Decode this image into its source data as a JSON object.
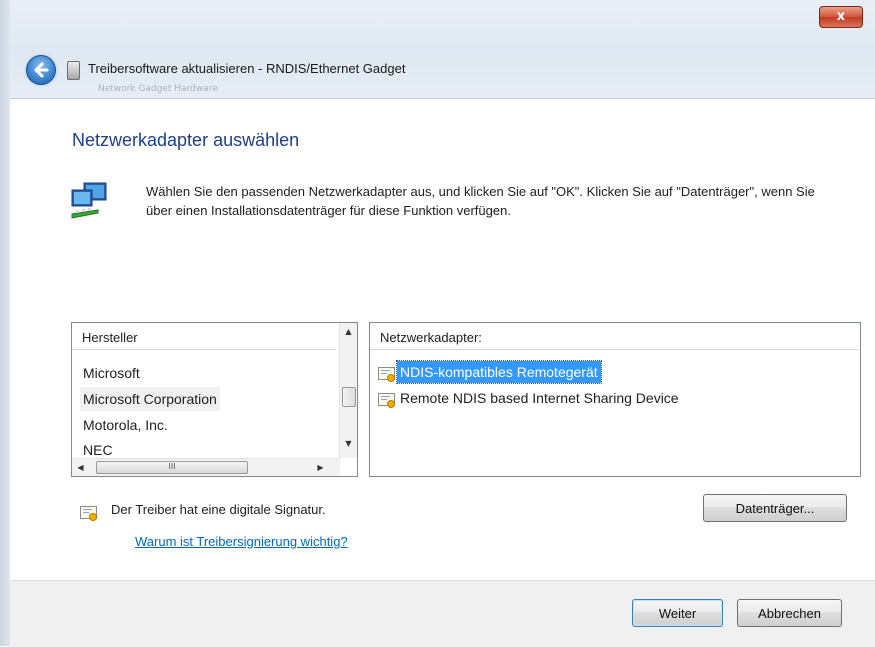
{
  "window": {
    "title": "Treibersoftware aktualisieren - RNDIS/Ethernet Gadget",
    "close_label": "x",
    "background_text": "Network Gadget Hardware"
  },
  "page": {
    "heading": "Netzwerkadapter auswählen",
    "instructions": "Wählen Sie den passenden Netzwerkadapter aus, und klicken Sie auf \"OK\". Klicken Sie auf \"Datenträger\", wenn Sie über einen Installationsdatenträger für diese Funktion verfügen."
  },
  "manufacturers": {
    "header": "Hersteller",
    "items": [
      {
        "label": "Microsoft",
        "selected": false
      },
      {
        "label": "Microsoft Corporation",
        "selected": true
      },
      {
        "label": "Motorola, Inc.",
        "selected": false
      },
      {
        "label": "NEC",
        "selected": false
      }
    ],
    "hscroll_thumb_label": "III"
  },
  "adapters": {
    "header": "Netzwerkadapter:",
    "items": [
      {
        "label": "NDIS-kompatibles Remotegerät",
        "selected": true,
        "icon": "certificate-icon"
      },
      {
        "label": "Remote NDIS based Internet Sharing Device",
        "selected": false,
        "icon": "certificate-icon"
      }
    ]
  },
  "signature": {
    "text": "Der Treiber hat eine digitale Signatur.",
    "link": "Warum ist Treibersignierung wichtig?"
  },
  "buttons": {
    "disk": "Datenträger...",
    "next": "Weiter",
    "cancel": "Abbrechen"
  },
  "colors": {
    "heading": "#1d3f8f",
    "link": "#0066cc",
    "selection": "#3399ff"
  }
}
